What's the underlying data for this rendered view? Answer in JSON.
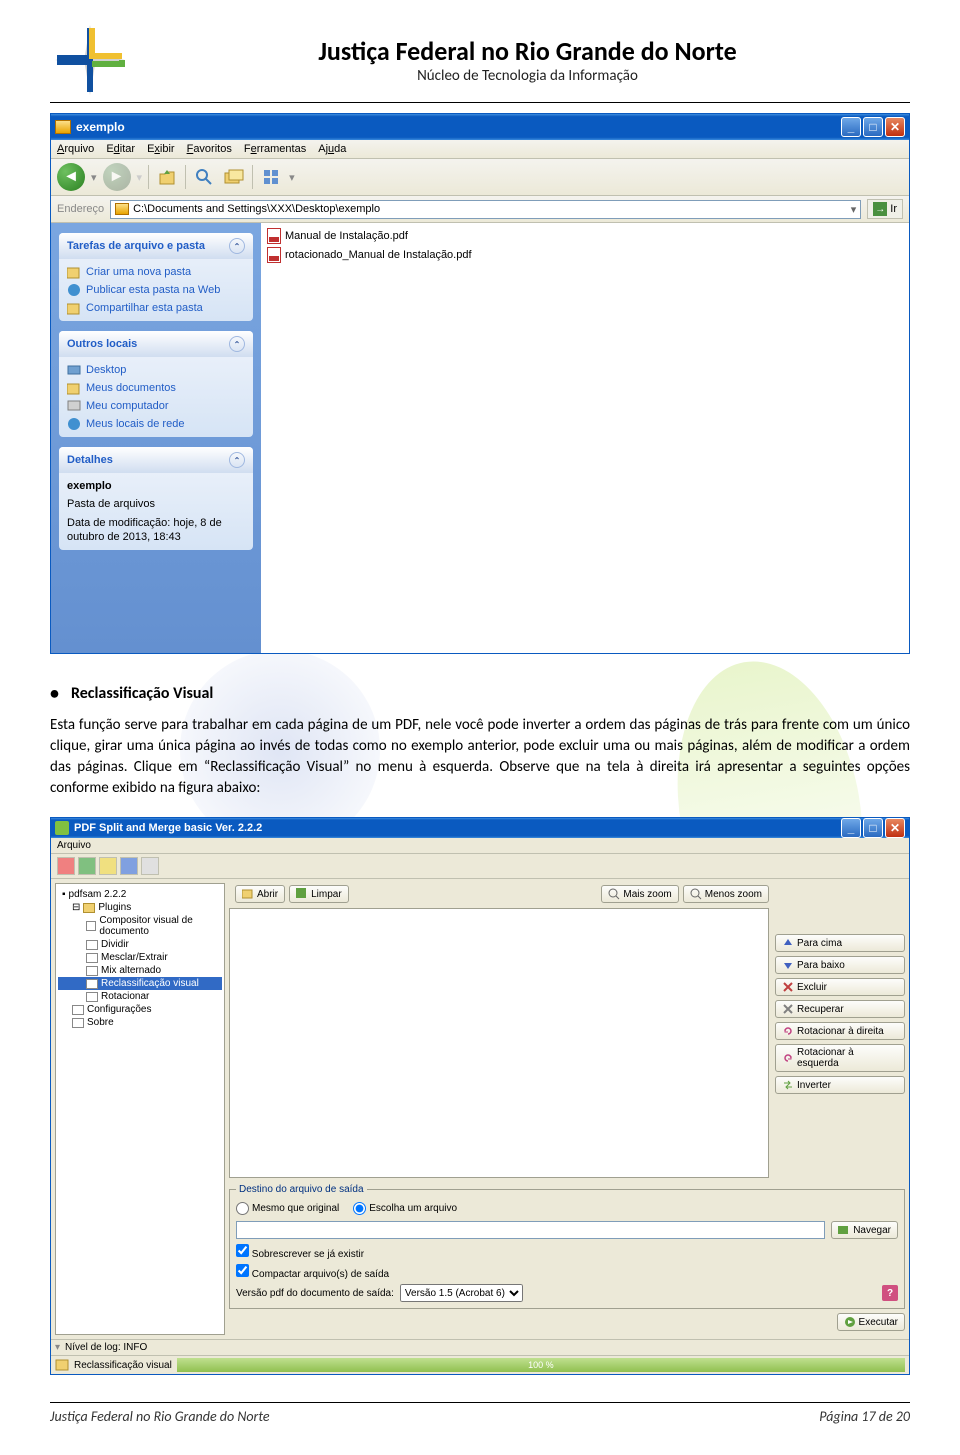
{
  "header": {
    "title": "Justiça Federal no Rio Grande do Norte",
    "subtitle": "Núcleo de Tecnologia da Informação"
  },
  "explorer": {
    "title": "exemplo",
    "menus": [
      "Arquivo",
      "Editar",
      "Exibir",
      "Favoritos",
      "Ferramentas",
      "Ajuda"
    ],
    "address_label": "Endereço",
    "address_value": "C:\\Documents and Settings\\XXX\\Desktop\\exemplo",
    "go_label": "Ir",
    "tasks": {
      "title": "Tarefas de arquivo e pasta",
      "items": [
        "Criar uma nova pasta",
        "Publicar esta pasta na Web",
        "Compartilhar esta pasta"
      ]
    },
    "places": {
      "title": "Outros locais",
      "items": [
        "Desktop",
        "Meus documentos",
        "Meu computador",
        "Meus locais de rede"
      ]
    },
    "details": {
      "title": "Detalhes",
      "name": "exemplo",
      "type": "Pasta de arquivos",
      "modified": "Data de modificação: hoje, 8 de outubro de 2013, 18:43"
    },
    "files": [
      "Manual de Instalação.pdf",
      "rotacionado_Manual de Instalação.pdf"
    ]
  },
  "section": {
    "heading": "Reclassificação Visual",
    "paragraph": "Esta função serve para trabalhar em cada página de um PDF, nele você pode inverter a ordem das páginas de trás para frente com um único clique, girar uma única página ao invés de todas como no exemplo anterior, pode excluir uma ou mais páginas, além de modificar a ordem das páginas. Clique em “Reclassificação Visual” no menu à esquerda. Observe que na tela à direita irá apresentar a seguintes opções conforme exibido na figura abaixo:"
  },
  "pdfsam": {
    "title": "PDF Split and Merge basic Ver. 2.2.2",
    "menu": "Arquivo",
    "tree": {
      "root": "pdfsam 2.2.2",
      "plugins": "Plugins",
      "items": [
        "Compositor visual de documento",
        "Dividir",
        "Mesclar/Extrair",
        "Mix alternado",
        "Reclassificação visual",
        "Rotacionar"
      ],
      "selected_index": 4,
      "config": "Configurações",
      "about": "Sobre"
    },
    "buttons": {
      "open": "Abrir",
      "clear": "Limpar",
      "zoom_in": "Mais zoom",
      "zoom_out": "Menos zoom",
      "up": "Para cima",
      "down": "Para baixo",
      "delete": "Excluir",
      "recover": "Recuperar",
      "rotate_right": "Rotacionar à direita",
      "rotate_left": "Rotacionar à esquerda",
      "invert": "Inverter",
      "browse": "Navegar",
      "execute": "Executar"
    },
    "dest": {
      "group_title": "Destino do arquivo de saída",
      "same_as_orig": "Mesmo que original",
      "choose_file": "Escolha um arquivo",
      "overwrite": "Sobrescrever se já existir",
      "compress": "Compactar arquivo(s) de saída",
      "pdf_version_label": "Versão pdf do documento de saída:",
      "pdf_version_value": "Versão 1.5 (Acrobat 6)"
    },
    "status": {
      "log_label": "Nível de log: INFO",
      "current": "Reclassificação visual",
      "progress": "100 %"
    }
  },
  "footer": {
    "left": "Justiça Federal no Rio Grande do Norte",
    "right": "Página 17 de 20"
  }
}
